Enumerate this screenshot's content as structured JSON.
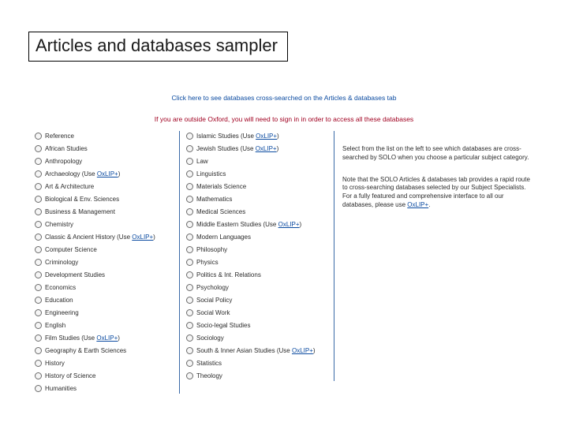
{
  "title": "Articles and databases sampler",
  "banner_link": "Click here to see databases cross-searched on the Articles & databases tab",
  "warning": "If you are outside Oxford, you will need to sign in in order to access all these databases",
  "oxlip_link": "OxLIP+",
  "col_a": [
    {
      "label": "Reference"
    },
    {
      "label": "African Studies"
    },
    {
      "label": "Anthropology"
    },
    {
      "label": "Archaeology",
      "suffix": "(Use ",
      "link": true,
      "suffix_end": ")"
    },
    {
      "label": "Art & Architecture"
    },
    {
      "label": "Biological & Env. Sciences"
    },
    {
      "label": "Business & Management"
    },
    {
      "label": "Chemistry"
    },
    {
      "label": "Classic & Ancient History",
      "suffix": "(Use ",
      "link": true,
      "suffix_end": ")"
    },
    {
      "label": "Computer Science"
    },
    {
      "label": "Criminology"
    },
    {
      "label": "Development Studies"
    },
    {
      "label": "Economics"
    },
    {
      "label": "Education"
    },
    {
      "label": "Engineering"
    },
    {
      "label": "English"
    },
    {
      "label": "Film Studies",
      "suffix": "(Use ",
      "link": true,
      "suffix_end": ")"
    },
    {
      "label": "Geography & Earth Sciences"
    },
    {
      "label": "History"
    },
    {
      "label": "History of Science"
    },
    {
      "label": "Humanities"
    }
  ],
  "col_b": [
    {
      "label": "Islamic Studies",
      "suffix": "(Use ",
      "link": true,
      "suffix_end": ")"
    },
    {
      "label": "Jewish Studies",
      "suffix": "(Use ",
      "link": true,
      "suffix_end": ")"
    },
    {
      "label": "Law"
    },
    {
      "label": "Linguistics"
    },
    {
      "label": "Materials Science"
    },
    {
      "label": "Mathematics"
    },
    {
      "label": "Medical Sciences"
    },
    {
      "label": "Middle Eastern Studies",
      "suffix": "(Use ",
      "link": true,
      "suffix_end": ")"
    },
    {
      "label": "Modern Languages"
    },
    {
      "label": "Philosophy"
    },
    {
      "label": "Physics"
    },
    {
      "label": "Politics & Int. Relations"
    },
    {
      "label": "Psychology"
    },
    {
      "label": "Social Policy"
    },
    {
      "label": "Social Work"
    },
    {
      "label": "Socio-legal Studies"
    },
    {
      "label": "Sociology"
    },
    {
      "label": "South & Inner Asian Studies",
      "suffix": "(Use ",
      "link": true,
      "suffix_end": ")"
    },
    {
      "label": "Statistics"
    },
    {
      "label": "Theology"
    }
  ],
  "info_1": "Select from the list on the left to see which databases are cross-searched by SOLO when you choose a particular subject category.",
  "info_2_a": "Note that the SOLO Articles & databases tab provides a rapid route to cross-searching databases selected by our Subject Specialists. For a fully featured and comprehensive interface to all our databases, please use ",
  "info_2_link": "OxLIP+",
  "info_2_b": "."
}
